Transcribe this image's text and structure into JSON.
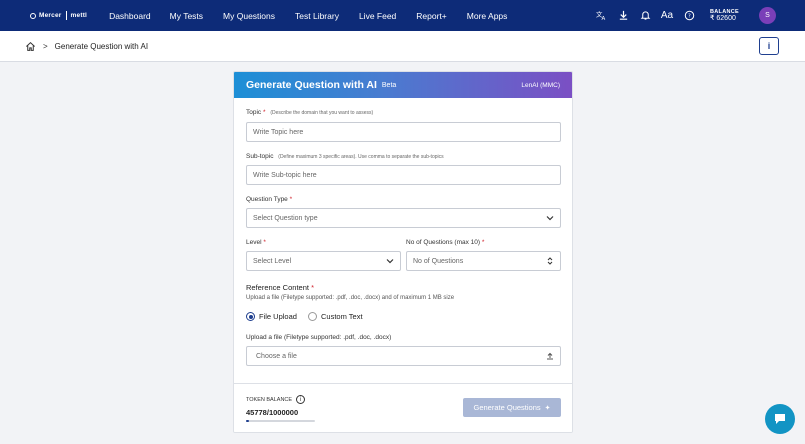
{
  "brand": {
    "name": "Mercer",
    "sub": "mettl"
  },
  "nav": {
    "items": [
      "Dashboard",
      "My Tests",
      "My Questions",
      "Test Library",
      "Live Feed",
      "Report+",
      "More Apps"
    ],
    "icons": [
      "translate-icon",
      "download-icon",
      "bell-icon",
      "font-size-icon",
      "help-icon"
    ],
    "font_size_label": "Aa",
    "balance_label": "BALANCE",
    "balance_value": "₹ 62600",
    "avatar_initial": "S"
  },
  "breadcrumb": {
    "separator": ">",
    "current": "Generate Question with AI",
    "info": "i"
  },
  "card": {
    "title": "Generate Question with AI",
    "badge": "Beta",
    "provider": "LenAI (MMC)",
    "topic": {
      "label": "Topic",
      "required": "*",
      "hint": "(Describe the domain that you want to assess)",
      "placeholder": "Write Topic here"
    },
    "subtopic": {
      "label": "Sub-topic",
      "hint": "(Define maximum 3 specific areas). Use comma to separate the sub-topics",
      "placeholder": "Write Sub-topic here"
    },
    "question_type": {
      "label": "Question Type",
      "required": "*",
      "selected": "Select Question type"
    },
    "level": {
      "label": "Level",
      "required": "*",
      "selected": "Select Level"
    },
    "num_questions": {
      "label": "No of Questions (max 10)",
      "required": "*",
      "placeholder": "No of Questions"
    },
    "reference": {
      "title": "Reference Content",
      "required": "*",
      "hint": "Upload a file (Filetype supported: .pdf, .doc, .docx) and of maximum 1 MB size",
      "options": [
        "File Upload",
        "Custom Text"
      ],
      "selected": "File Upload",
      "upload_label": "Upload a file (Filetype supported: .pdf, .doc, .docx)",
      "upload_placeholder": "Choose a file"
    },
    "token": {
      "label": "TOKEN BALANCE",
      "used": "45778",
      "total": "/1000000",
      "fraction": 0.045778
    },
    "generate_button": "Generate Questions",
    "colors": {
      "accent": "#0d2b78",
      "header_start": "#1d8fd6",
      "header_end": "#7b4fc4",
      "required": "#d0202a"
    }
  },
  "chat": {
    "icon": "chat-icon",
    "color": "#1294c4"
  }
}
